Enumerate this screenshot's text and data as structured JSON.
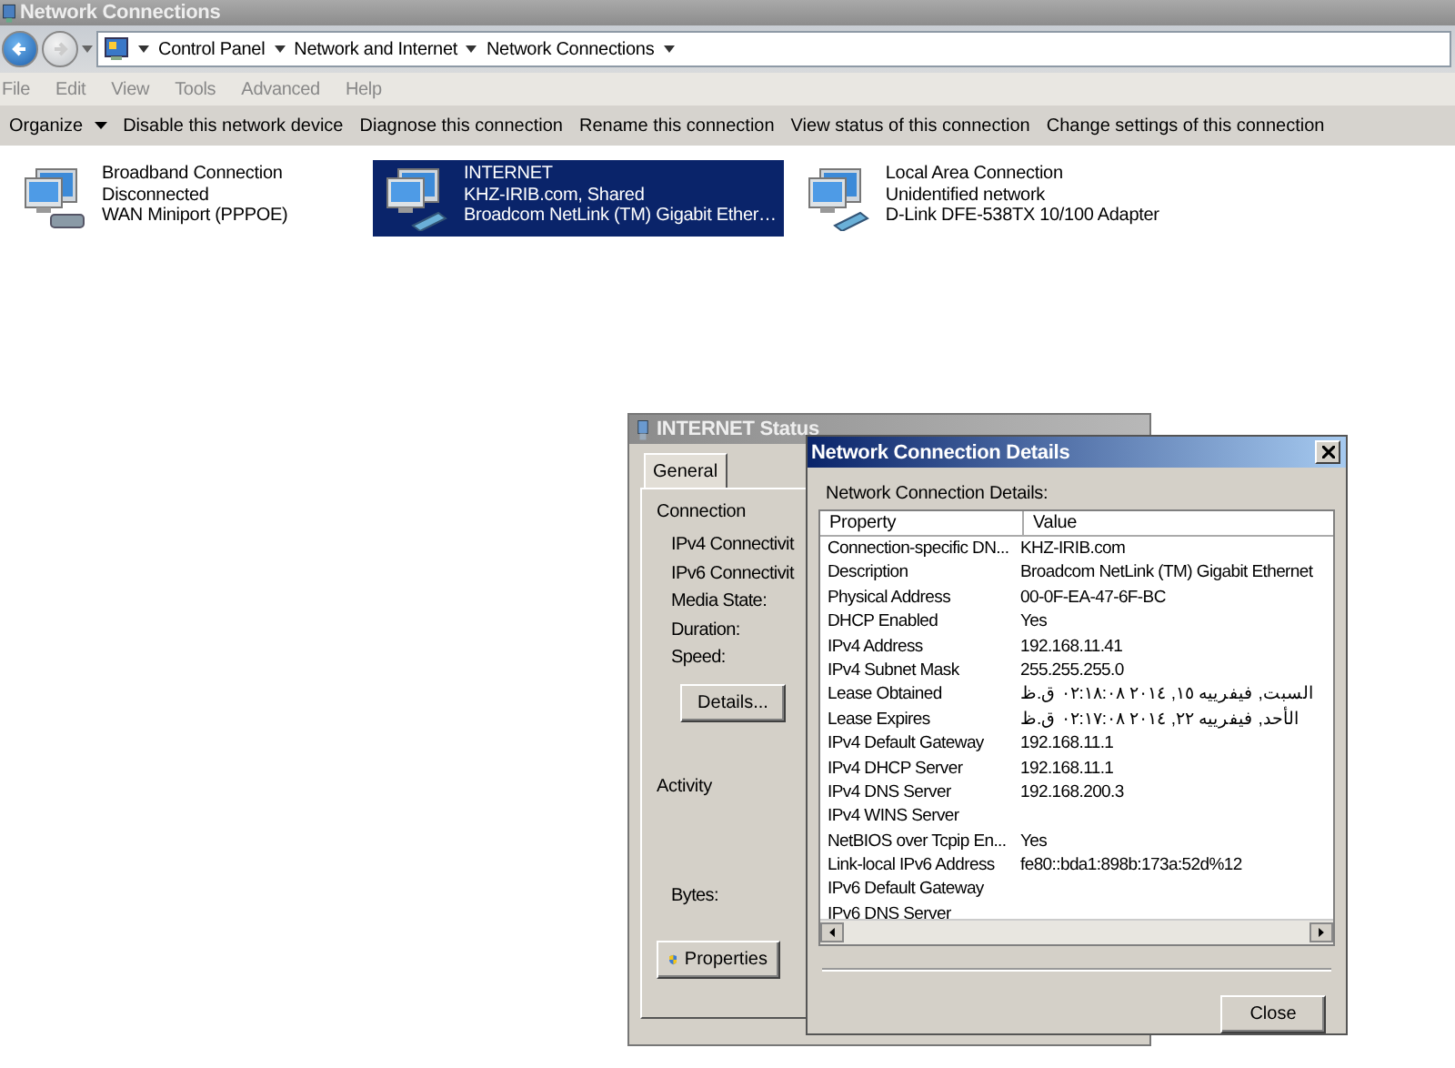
{
  "window": {
    "title": "Network Connections"
  },
  "address": {
    "crumbs": [
      "Control Panel",
      "Network and Internet",
      "Network Connections"
    ]
  },
  "menu": [
    "File",
    "Edit",
    "View",
    "Tools",
    "Advanced",
    "Help"
  ],
  "commands": [
    {
      "label": "Organize",
      "dropdown": true
    },
    {
      "label": "Disable this network device",
      "dropdown": false
    },
    {
      "label": "Diagnose this connection",
      "dropdown": false
    },
    {
      "label": "Rename this connection",
      "dropdown": false
    },
    {
      "label": "View status of this connection",
      "dropdown": false
    },
    {
      "label": "Change settings of this connection",
      "dropdown": false
    }
  ],
  "connections": [
    {
      "name": "Broadband Connection",
      "status": "Disconnected",
      "device": "WAN Miniport (PPPOE)",
      "selected": false,
      "kind": "modem"
    },
    {
      "name": "INTERNET",
      "status": "KHZ-IRIB.com, Shared",
      "device": "Broadcom NetLink (TM) Gigabit Ether…",
      "selected": true,
      "kind": "network"
    },
    {
      "name": "Local Area Connection",
      "status": "Unidentified network",
      "device": "D-Link DFE-538TX 10/100 Adapter",
      "selected": false,
      "kind": "network"
    }
  ],
  "status_dialog": {
    "title": "INTERNET Status",
    "tabs": [
      {
        "label": "General",
        "selected": true
      }
    ],
    "connection_heading": "Connection",
    "connection_fields": [
      "IPv4 Connectivit",
      "IPv6 Connectivit",
      "Media State:",
      "Duration:",
      "Speed:"
    ],
    "details_button": "Details...",
    "activity_heading": "Activity",
    "bytes_label": "Bytes:",
    "properties_button": "Properties"
  },
  "details_dialog": {
    "title": "Network Connection Details",
    "label": "Network Connection Details:",
    "columns": [
      "Property",
      "Value"
    ],
    "rows": [
      {
        "property": "Connection-specific DN...",
        "value": "KHZ-IRIB.com"
      },
      {
        "property": "Description",
        "value": "Broadcom NetLink (TM) Gigabit Ethernet"
      },
      {
        "property": "Physical Address",
        "value": "00-0F-EA-47-6F-BC"
      },
      {
        "property": "DHCP Enabled",
        "value": "Yes"
      },
      {
        "property": "IPv4 Address",
        "value": "192.168.11.41"
      },
      {
        "property": "IPv4 Subnet Mask",
        "value": "255.255.255.0"
      },
      {
        "property": "Lease Obtained",
        "value": "السبت, فيفرييه ١٥, ٢٠١٤ ٠٢:١٨:٠٨ ق.ظ"
      },
      {
        "property": "Lease Expires",
        "value": "الأحد, فيفرييه ٢٢, ٢٠١٤ ٠٢:١٧:٠٨ ق.ظ"
      },
      {
        "property": "IPv4 Default Gateway",
        "value": "192.168.11.1"
      },
      {
        "property": "IPv4 DHCP Server",
        "value": "192.168.11.1"
      },
      {
        "property": "IPv4 DNS Server",
        "value": "192.168.200.3"
      },
      {
        "property": "IPv4 WINS Server"
      },
      {
        "property": "NetBIOS over Tcpip En...",
        "value": "Yes"
      },
      {
        "property": "Link-local IPv6 Address",
        "value": "fe80::bda1:898b:173a:52d%12"
      },
      {
        "property": "IPv6 Default Gateway"
      },
      {
        "property": "IPv6 DNS Server"
      }
    ],
    "close_button": "Close"
  }
}
